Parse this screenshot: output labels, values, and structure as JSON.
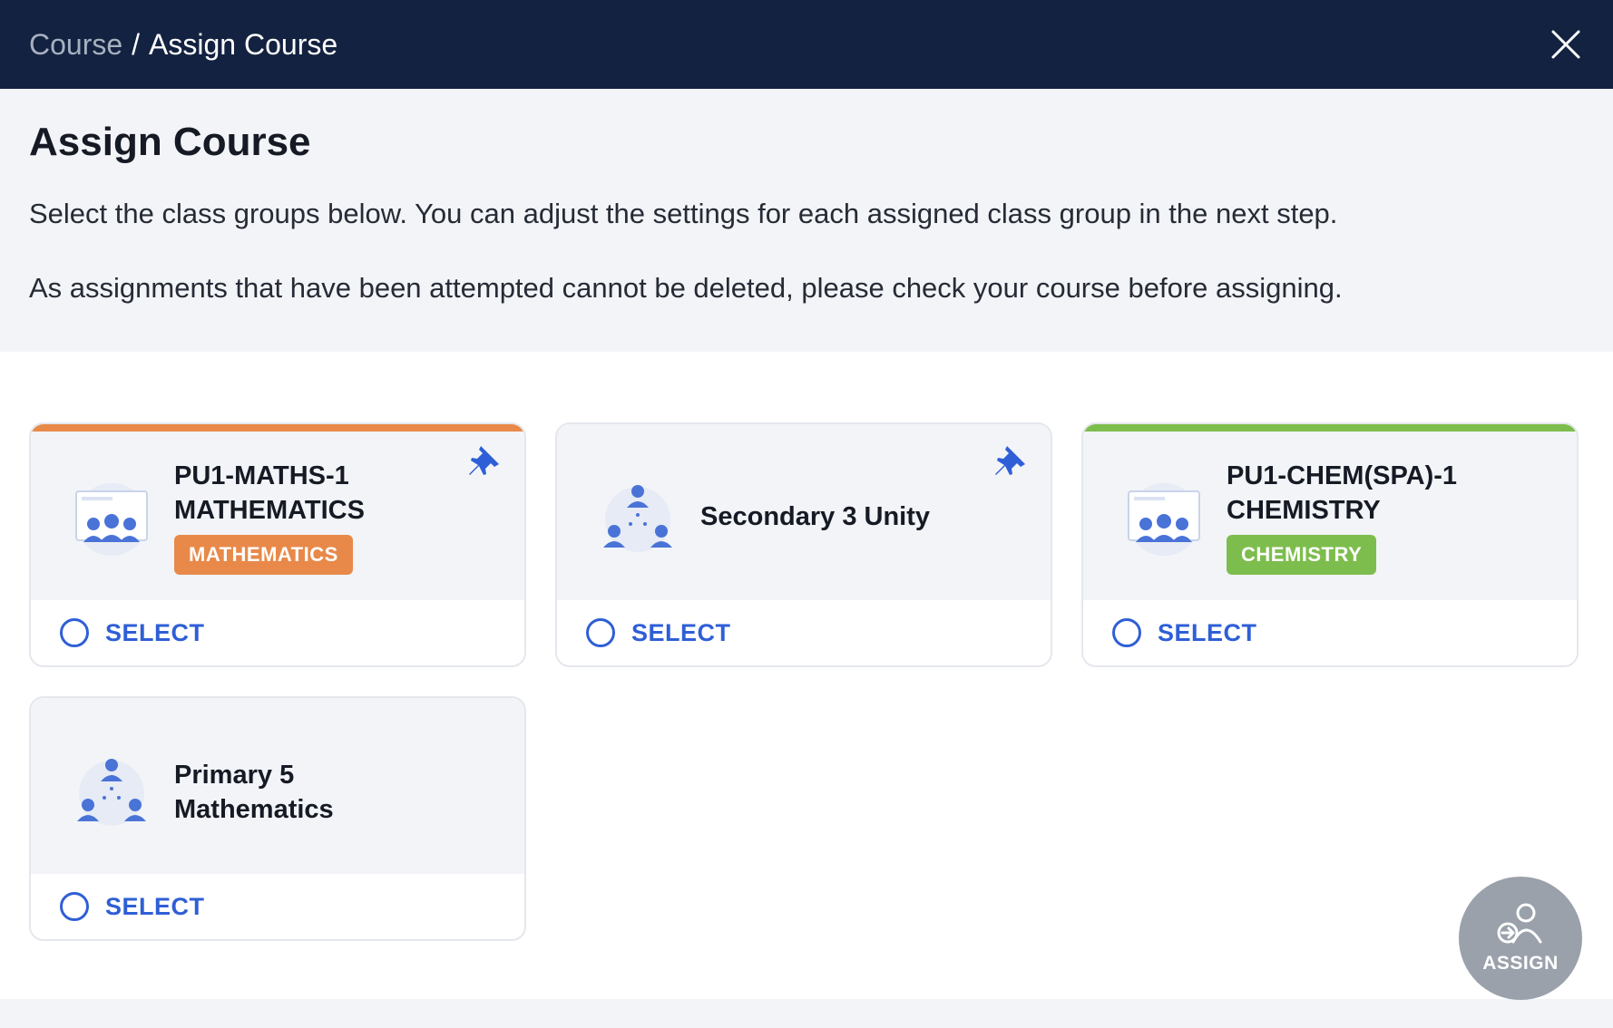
{
  "header": {
    "breadcrumb_root": "Course",
    "breadcrumb_separator": "/",
    "breadcrumb_current": "Assign Course",
    "close_icon": "close-icon"
  },
  "intro": {
    "title": "Assign Course",
    "line1": "Select the class groups below. You can adjust the settings for each assigned class group in the next step.",
    "line2": "As assignments that have been attempted cannot be deleted, please check your course before assigning."
  },
  "cards": [
    {
      "title_line1": "PU1-MATHS-1",
      "title_line2": "MATHEMATICS",
      "tag": "MATHEMATICS",
      "tag_color": "#e8894a",
      "accent": "#e8894a",
      "icon": "classroom-icon",
      "pinned": true,
      "select_label": "SELECT"
    },
    {
      "title_line1": "Secondary 3 Unity",
      "icon": "group-network-icon",
      "pinned": true,
      "select_label": "SELECT"
    },
    {
      "title_line1": "PU1-CHEM(SPA)-1",
      "title_line2": "CHEMISTRY",
      "tag": "CHEMISTRY",
      "tag_color": "#7dbd4d",
      "accent": "#7dbd4d",
      "icon": "classroom-icon",
      "pinned": false,
      "select_label": "SELECT"
    },
    {
      "title_line1": "Primary 5",
      "title_line2": "Mathematics",
      "icon": "group-network-icon",
      "pinned": false,
      "select_label": "SELECT"
    }
  ],
  "assign_button": {
    "label": "ASSIGN",
    "icon": "assign-user-icon"
  },
  "colors": {
    "header_bg": "#132240",
    "link_blue": "#2f5fd6"
  }
}
